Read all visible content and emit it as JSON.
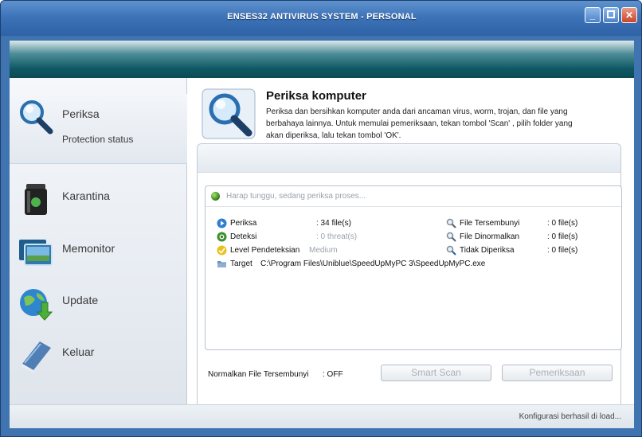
{
  "window": {
    "title": "ENSES32 ANTIVIRUS SYSTEM - PERSONAL",
    "controls": {
      "minimize": "_",
      "close": "✕"
    }
  },
  "sidebar": {
    "items": [
      {
        "label": "Periksa",
        "sub": "Protection status",
        "icon": "magnifier-icon",
        "active": true
      },
      {
        "label": "Karantina",
        "icon": "trash-bin-icon"
      },
      {
        "label": "Memonitor",
        "icon": "monitor-icon"
      },
      {
        "label": "Update",
        "icon": "globe-download-icon"
      },
      {
        "label": "Keluar",
        "icon": "book-icon"
      }
    ]
  },
  "header": {
    "title": "Periksa komputer",
    "description": "Periksa dan bersihkan komputer anda dari ancaman virus, worm, trojan, dan file yang berbahaya lainnya. Untuk memulai pemeriksaan, tekan tombol 'Scan' , pilih folder yang akan diperiksa, lalu tekan tombol 'OK'.",
    "icon": "magnifier-icon"
  },
  "scan": {
    "status": "Harap tunggu, sedang periksa proses...",
    "left": [
      {
        "label": "Periksa",
        "value": ": 34 file(s)",
        "icon": "play-icon"
      },
      {
        "label": "Deteksi",
        "value": ": 0 threat(s)",
        "icon": "eye-icon"
      },
      {
        "label": "Level Pendeteksian",
        "value": "Medium",
        "icon": "level-icon"
      }
    ],
    "right": [
      {
        "label": "File Tersembunyi",
        "value": ": 0 file(s)",
        "icon": "search-icon"
      },
      {
        "label": "File Dinormalkan",
        "value": ": 0 file(s)",
        "icon": "search-icon"
      },
      {
        "label": "Tidak Diperiksa",
        "value": ": 0 file(s)",
        "icon": "search-person-icon"
      }
    ],
    "target_label": "Target",
    "target_path": "C:\\Program Files\\Uniblue\\SpeedUpMyPC 3\\SpeedUpMyPC.exe",
    "target_icon": "folder-icon"
  },
  "options": {
    "normalize_label": "Normalkan File Tersembunyi",
    "normalize_value": ": OFF"
  },
  "buttons": {
    "smart_scan": "Smart Scan",
    "pemeriksaan": "Pemeriksaan"
  },
  "statusbar": {
    "message": "Konfigurasi berhasil di load..."
  },
  "colors": {
    "titlebar": "#3d73b8",
    "banner": "#0f5964",
    "disabled_text": "#a9b1ba"
  }
}
